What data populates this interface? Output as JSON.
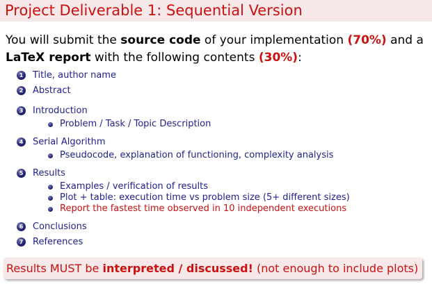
{
  "title": "Project Deliverable 1: Sequential Version",
  "intro": {
    "t1": "You will submit the ",
    "source_code": "source code",
    "t2": " of your implementation ",
    "pct_code": "(70%)",
    "t3": " and a",
    "latex_report": "LaTeX report",
    "t4": " with the following contents ",
    "pct_report": "(30%)",
    "t5": ":"
  },
  "items": [
    {
      "num": "1",
      "label": "Title, author name"
    },
    {
      "num": "2",
      "label": "Abstract"
    },
    {
      "num": "3",
      "label": "Introduction",
      "sub": [
        "Problem / Task / Topic Description"
      ]
    },
    {
      "num": "4",
      "label": "Serial Algorithm",
      "sub": [
        "Pseudocode, explanation of functioning, complexity analysis"
      ]
    },
    {
      "num": "5",
      "label": "Results",
      "sub": [
        "Examples / verification of results",
        "Plot + table: execution time vs problem size (5+ different sizes)",
        "Report the fastest time observed in 10 independent executions"
      ]
    },
    {
      "num": "6",
      "label": "Conclusions"
    },
    {
      "num": "7",
      "label": "References"
    }
  ],
  "footer": {
    "t1": "Results MUST be ",
    "b1": "interpreted / discussed!",
    "t2": " (not enough to include plots)"
  },
  "colors": {
    "accent": "#cc1010",
    "list_text": "#1f1f8f",
    "box_bg": "#f7e9e9"
  }
}
